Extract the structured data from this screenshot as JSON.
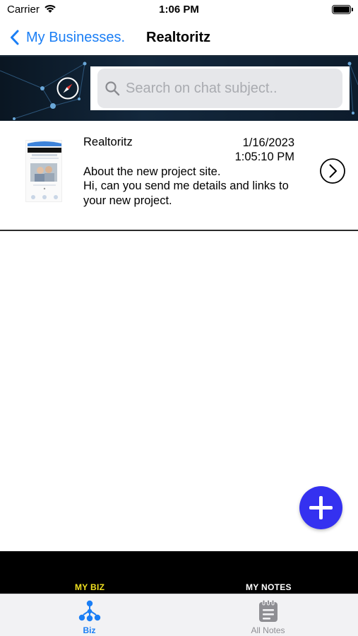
{
  "status_bar": {
    "carrier": "Carrier",
    "time": "1:06 PM"
  },
  "nav": {
    "back_label": "My Businesses.",
    "title": "Realtoritz"
  },
  "search": {
    "placeholder": "Search on chat subject.."
  },
  "chats": [
    {
      "business": "Realtoritz",
      "date": "1/16/2023",
      "time": "1:05:10 PM",
      "subject": "About the new project site.",
      "preview": "Hi, can you send me details and links to your new project."
    }
  ],
  "section_bar": {
    "biz": "MY BIZ",
    "notes": "MY NOTES"
  },
  "tabs": {
    "biz": "Biz",
    "notes": "All Notes"
  },
  "colors": {
    "accent": "#1a7ef5",
    "fab": "#3431f0",
    "section_biz": "#f0e020"
  }
}
